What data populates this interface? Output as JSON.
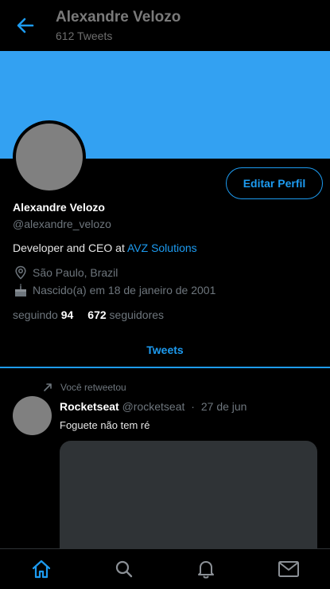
{
  "header": {
    "title": "Alexandre Velozo",
    "subtitle": "612 Tweets"
  },
  "profile": {
    "edit_label": "Editar Perfil",
    "name": "Alexandre Velozo",
    "handle": "@alexandre_velozo",
    "bio_text": "Developer and CEO at ",
    "bio_link": "AVZ Solutions",
    "location": "São Paulo, Brazil",
    "birthday": "Nascido(a) em 18 de janeiro de 2001",
    "following_label": "seguindo",
    "following_count": "94",
    "followers_count": "672",
    "followers_label": "seguidores"
  },
  "tabs": {
    "active": "Tweets"
  },
  "tweet": {
    "retweet_label": "Você retweetou",
    "author": "Rocketseat",
    "handle": "@rocketseat",
    "separator": "·",
    "date": "27 de jun",
    "text": "Foguete não tem ré"
  },
  "nav": {
    "items": [
      "home-icon",
      "search-icon",
      "bell-icon",
      "mail-icon"
    ],
    "active": "home-icon"
  },
  "colors": {
    "accent": "#1d9bf0",
    "banner": "#33a1f2",
    "background": "#000000"
  }
}
